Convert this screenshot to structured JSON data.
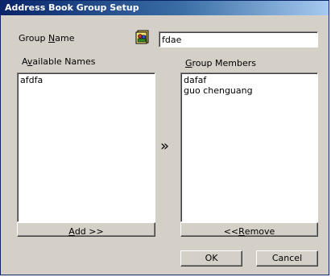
{
  "window": {
    "title": "Address Book Group Setup"
  },
  "group_name": {
    "label_pre": "Group ",
    "label_key": "N",
    "label_post": "ame",
    "value": "fdae",
    "icon": "address-book-icon"
  },
  "available": {
    "label_pre": "A",
    "label_key": "v",
    "label_post": "ailable Names",
    "items": [
      "afdfa"
    ]
  },
  "members": {
    "label_pre": "",
    "label_key": "G",
    "label_post": "roup Members",
    "items": [
      "dafaf",
      "guo chenguang"
    ]
  },
  "transfer_arrow": "»",
  "buttons": {
    "add_key": "A",
    "add_post": "dd >>",
    "remove_pre": "<< ",
    "remove_key": "R",
    "remove_post": "emove",
    "ok": "OK",
    "cancel": "Cancel"
  }
}
